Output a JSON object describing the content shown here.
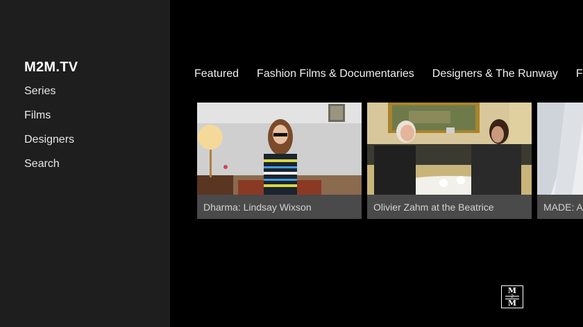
{
  "sidebar": {
    "brand": "M2M.TV",
    "items": [
      {
        "label": "Series"
      },
      {
        "label": "Films"
      },
      {
        "label": "Designers"
      },
      {
        "label": "Search"
      }
    ]
  },
  "tabs": [
    {
      "label": "Featured"
    },
    {
      "label": "Fashion Films & Documentaries"
    },
    {
      "label": "Designers & The Runway"
    },
    {
      "label": "Fas"
    }
  ],
  "cards": [
    {
      "title": "Dharma: Lindsay Wixson"
    },
    {
      "title": "Olivier Zahm at the Beatrice"
    },
    {
      "title": "MADE: Ar"
    }
  ],
  "logo": {
    "top": "M",
    "middle": "2",
    "bottom": "M"
  },
  "colors": {
    "sidebar_bg": "#1e1e1e",
    "main_bg": "#000000",
    "caption_bar": "#4a4a4a"
  }
}
